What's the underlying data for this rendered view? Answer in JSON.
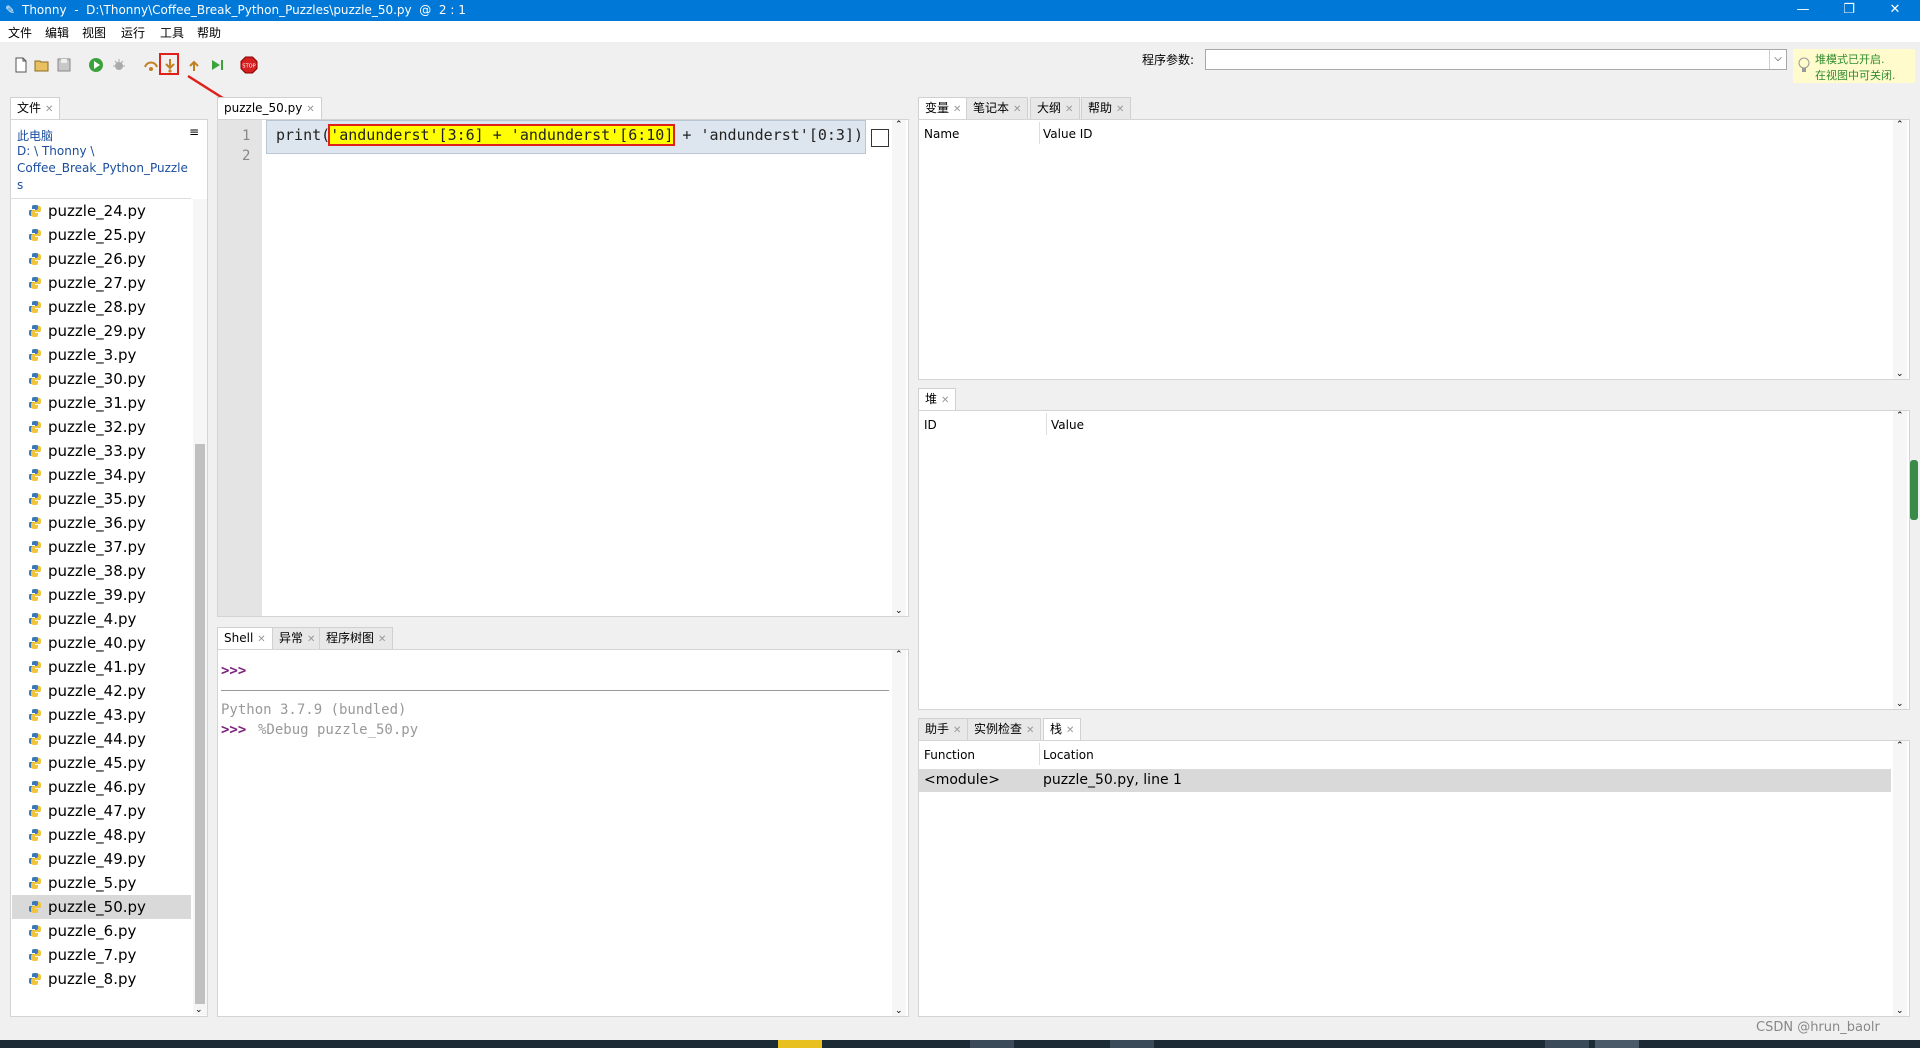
{
  "window": {
    "title": "Thonny  -  D:\\Thonny\\Coffee_Break_Python_Puzzles\\puzzle_50.py  @  2 : 1",
    "minimize": "—",
    "maximize": "❐",
    "close": "✕"
  },
  "menu": [
    "文件",
    "编辑",
    "视图",
    "运行",
    "工具",
    "帮助"
  ],
  "toolbar": {
    "args_label": "程序参数:",
    "args_value": "",
    "hint_line1": "堆模式已开启.",
    "hint_line2": "在视图中可关闭."
  },
  "files": {
    "tab": "文件",
    "path_label": "此电脑",
    "path_line1": "D: \\ Thonny \\",
    "path_line2": "Coffee_Break_Python_Puzzle",
    "path_line3": "s",
    "items": [
      "puzzle_24.py",
      "puzzle_25.py",
      "puzzle_26.py",
      "puzzle_27.py",
      "puzzle_28.py",
      "puzzle_29.py",
      "puzzle_3.py",
      "puzzle_30.py",
      "puzzle_31.py",
      "puzzle_32.py",
      "puzzle_33.py",
      "puzzle_34.py",
      "puzzle_35.py",
      "puzzle_36.py",
      "puzzle_37.py",
      "puzzle_38.py",
      "puzzle_39.py",
      "puzzle_4.py",
      "puzzle_40.py",
      "puzzle_41.py",
      "puzzle_42.py",
      "puzzle_43.py",
      "puzzle_44.py",
      "puzzle_45.py",
      "puzzle_46.py",
      "puzzle_47.py",
      "puzzle_48.py",
      "puzzle_49.py",
      "puzzle_5.py",
      "puzzle_50.py",
      "puzzle_6.py",
      "puzzle_7.py",
      "puzzle_8.py"
    ],
    "selected": "puzzle_50.py"
  },
  "editor": {
    "tab": "puzzle_50.py",
    "line_numbers": [
      "1",
      "2"
    ],
    "code_pre": "print(",
    "code_highlight": "'andunderst'[3:6] + 'andunderst'[6:10]",
    "code_post": " + 'andunderst'[0:3])"
  },
  "shell": {
    "tabs": [
      "Shell",
      "异常",
      "程序树图"
    ],
    "prompt": ">>>",
    "banner": "Python 3.7.9 (bundled)",
    "cmd": "%Debug puzzle_50.py"
  },
  "variables": {
    "tabs": [
      "变量",
      "笔记本",
      "大纲",
      "帮助"
    ],
    "col_name": "Name",
    "col_value": "Value ID"
  },
  "heap": {
    "tab": "堆",
    "col_id": "ID",
    "col_value": "Value"
  },
  "stack": {
    "tabs": [
      "助手",
      "实例检查",
      "栈"
    ],
    "col_function": "Function",
    "col_location": "Location",
    "rows": [
      {
        "function": "<module>",
        "location": "puzzle_50.py, line 1"
      }
    ]
  },
  "watermark": "CSDN @hrun_baolr",
  "colors": {
    "titlebar": "#0078d7",
    "highlight_box": "#e0201b",
    "highlight_fill": "#ffff00",
    "prompt": "#7a1f7a",
    "hint_text": "#2e8b2e"
  }
}
